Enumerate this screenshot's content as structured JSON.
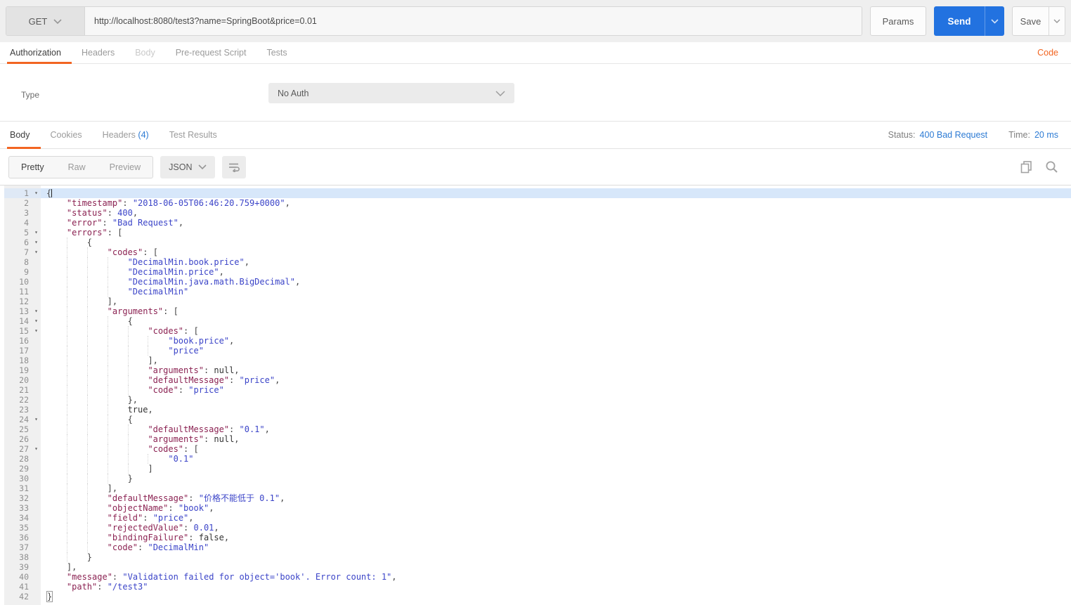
{
  "request_bar": {
    "method": "GET",
    "url": "http://localhost:8080/test3?name=SpringBoot&price=0.01",
    "params_label": "Params",
    "send_label": "Send",
    "save_label": "Save"
  },
  "request_tabs": {
    "authorization": "Authorization",
    "headers": "Headers",
    "body": "Body",
    "prerequest": "Pre-request Script",
    "tests": "Tests",
    "code_link": "Code"
  },
  "auth": {
    "type_label": "Type",
    "type_value": "No Auth"
  },
  "response_tabs": {
    "body": "Body",
    "cookies": "Cookies",
    "headers": "Headers",
    "headers_count": "(4)",
    "test_results": "Test Results",
    "status_label": "Status:",
    "status_value": "400 Bad Request",
    "time_label": "Time:",
    "time_value": "20 ms"
  },
  "viewer": {
    "mode_pretty": "Pretty",
    "mode_raw": "Raw",
    "mode_preview": "Preview",
    "language": "JSON",
    "icons": [
      "chevron-down-icon",
      "wrap-text-icon",
      "copy-icon",
      "search-icon"
    ]
  },
  "colors": {
    "accent_orange": "#f26522",
    "send_blue": "#2272e0",
    "link_blue": "#2d7bd4",
    "json_key": "#8b2252",
    "json_string_number": "#3b44c8",
    "active_line_bg": "#d7e7fa"
  },
  "code": {
    "active_line": 1,
    "cursor_line": 1,
    "bracket_box_line": 42,
    "fold_lines": [
      1,
      5,
      6,
      7,
      13,
      14,
      15,
      24,
      27
    ],
    "lines": [
      {
        "n": 1,
        "indent": 0,
        "tokens": [
          [
            "p",
            "{"
          ]
        ]
      },
      {
        "n": 2,
        "indent": 1,
        "tokens": [
          [
            "k",
            "\"timestamp\""
          ],
          [
            "p",
            ": "
          ],
          [
            "s",
            "\"2018-06-05T06:46:20.759+0000\""
          ],
          [
            "p",
            ","
          ]
        ]
      },
      {
        "n": 3,
        "indent": 1,
        "tokens": [
          [
            "k",
            "\"status\""
          ],
          [
            "p",
            ": "
          ],
          [
            "n",
            "400"
          ],
          [
            "p",
            ","
          ]
        ]
      },
      {
        "n": 4,
        "indent": 1,
        "tokens": [
          [
            "k",
            "\"error\""
          ],
          [
            "p",
            ": "
          ],
          [
            "s",
            "\"Bad Request\""
          ],
          [
            "p",
            ","
          ]
        ]
      },
      {
        "n": 5,
        "indent": 1,
        "tokens": [
          [
            "k",
            "\"errors\""
          ],
          [
            "p",
            ": ["
          ]
        ]
      },
      {
        "n": 6,
        "indent": 2,
        "tokens": [
          [
            "p",
            "{"
          ]
        ]
      },
      {
        "n": 7,
        "indent": 3,
        "tokens": [
          [
            "k",
            "\"codes\""
          ],
          [
            "p",
            ": ["
          ]
        ]
      },
      {
        "n": 8,
        "indent": 4,
        "tokens": [
          [
            "s",
            "\"DecimalMin.book.price\""
          ],
          [
            "p",
            ","
          ]
        ]
      },
      {
        "n": 9,
        "indent": 4,
        "tokens": [
          [
            "s",
            "\"DecimalMin.price\""
          ],
          [
            "p",
            ","
          ]
        ]
      },
      {
        "n": 10,
        "indent": 4,
        "tokens": [
          [
            "s",
            "\"DecimalMin.java.math.BigDecimal\""
          ],
          [
            "p",
            ","
          ]
        ]
      },
      {
        "n": 11,
        "indent": 4,
        "tokens": [
          [
            "s",
            "\"DecimalMin\""
          ]
        ]
      },
      {
        "n": 12,
        "indent": 3,
        "tokens": [
          [
            "p",
            "],"
          ]
        ]
      },
      {
        "n": 13,
        "indent": 3,
        "tokens": [
          [
            "k",
            "\"arguments\""
          ],
          [
            "p",
            ": ["
          ]
        ]
      },
      {
        "n": 14,
        "indent": 4,
        "tokens": [
          [
            "p",
            "{"
          ]
        ]
      },
      {
        "n": 15,
        "indent": 5,
        "tokens": [
          [
            "k",
            "\"codes\""
          ],
          [
            "p",
            ": ["
          ]
        ]
      },
      {
        "n": 16,
        "indent": 6,
        "tokens": [
          [
            "s",
            "\"book.price\""
          ],
          [
            "p",
            ","
          ]
        ]
      },
      {
        "n": 17,
        "indent": 6,
        "tokens": [
          [
            "s",
            "\"price\""
          ]
        ]
      },
      {
        "n": 18,
        "indent": 5,
        "tokens": [
          [
            "p",
            "],"
          ]
        ]
      },
      {
        "n": 19,
        "indent": 5,
        "tokens": [
          [
            "k",
            "\"arguments\""
          ],
          [
            "p",
            ": "
          ],
          [
            "a",
            "null"
          ],
          [
            "p",
            ","
          ]
        ]
      },
      {
        "n": 20,
        "indent": 5,
        "tokens": [
          [
            "k",
            "\"defaultMessage\""
          ],
          [
            "p",
            ": "
          ],
          [
            "s",
            "\"price\""
          ],
          [
            "p",
            ","
          ]
        ]
      },
      {
        "n": 21,
        "indent": 5,
        "tokens": [
          [
            "k",
            "\"code\""
          ],
          [
            "p",
            ": "
          ],
          [
            "s",
            "\"price\""
          ]
        ]
      },
      {
        "n": 22,
        "indent": 4,
        "tokens": [
          [
            "p",
            "},"
          ]
        ]
      },
      {
        "n": 23,
        "indent": 4,
        "tokens": [
          [
            "a",
            "true"
          ],
          [
            "p",
            ","
          ]
        ]
      },
      {
        "n": 24,
        "indent": 4,
        "tokens": [
          [
            "p",
            "{"
          ]
        ]
      },
      {
        "n": 25,
        "indent": 5,
        "tokens": [
          [
            "k",
            "\"defaultMessage\""
          ],
          [
            "p",
            ": "
          ],
          [
            "s",
            "\"0.1\""
          ],
          [
            "p",
            ","
          ]
        ]
      },
      {
        "n": 26,
        "indent": 5,
        "tokens": [
          [
            "k",
            "\"arguments\""
          ],
          [
            "p",
            ": "
          ],
          [
            "a",
            "null"
          ],
          [
            "p",
            ","
          ]
        ]
      },
      {
        "n": 27,
        "indent": 5,
        "tokens": [
          [
            "k",
            "\"codes\""
          ],
          [
            "p",
            ": ["
          ]
        ]
      },
      {
        "n": 28,
        "indent": 6,
        "tokens": [
          [
            "s",
            "\"0.1\""
          ]
        ]
      },
      {
        "n": 29,
        "indent": 5,
        "tokens": [
          [
            "p",
            "]"
          ]
        ]
      },
      {
        "n": 30,
        "indent": 4,
        "tokens": [
          [
            "p",
            "}"
          ]
        ]
      },
      {
        "n": 31,
        "indent": 3,
        "tokens": [
          [
            "p",
            "],"
          ]
        ]
      },
      {
        "n": 32,
        "indent": 3,
        "tokens": [
          [
            "k",
            "\"defaultMessage\""
          ],
          [
            "p",
            ": "
          ],
          [
            "s",
            "\"价格不能低于 0.1\""
          ],
          [
            "p",
            ","
          ]
        ]
      },
      {
        "n": 33,
        "indent": 3,
        "tokens": [
          [
            "k",
            "\"objectName\""
          ],
          [
            "p",
            ": "
          ],
          [
            "s",
            "\"book\""
          ],
          [
            "p",
            ","
          ]
        ]
      },
      {
        "n": 34,
        "indent": 3,
        "tokens": [
          [
            "k",
            "\"field\""
          ],
          [
            "p",
            ": "
          ],
          [
            "s",
            "\"price\""
          ],
          [
            "p",
            ","
          ]
        ]
      },
      {
        "n": 35,
        "indent": 3,
        "tokens": [
          [
            "k",
            "\"rejectedValue\""
          ],
          [
            "p",
            ": "
          ],
          [
            "n",
            "0.01"
          ],
          [
            "p",
            ","
          ]
        ]
      },
      {
        "n": 36,
        "indent": 3,
        "tokens": [
          [
            "k",
            "\"bindingFailure\""
          ],
          [
            "p",
            ": "
          ],
          [
            "a",
            "false"
          ],
          [
            "p",
            ","
          ]
        ]
      },
      {
        "n": 37,
        "indent": 3,
        "tokens": [
          [
            "k",
            "\"code\""
          ],
          [
            "p",
            ": "
          ],
          [
            "s",
            "\"DecimalMin\""
          ]
        ]
      },
      {
        "n": 38,
        "indent": 2,
        "tokens": [
          [
            "p",
            "}"
          ]
        ]
      },
      {
        "n": 39,
        "indent": 1,
        "tokens": [
          [
            "p",
            "],"
          ]
        ]
      },
      {
        "n": 40,
        "indent": 1,
        "tokens": [
          [
            "k",
            "\"message\""
          ],
          [
            "p",
            ": "
          ],
          [
            "s",
            "\"Validation failed for object='book'. Error count: 1\""
          ],
          [
            "p",
            ","
          ]
        ]
      },
      {
        "n": 41,
        "indent": 1,
        "tokens": [
          [
            "k",
            "\"path\""
          ],
          [
            "p",
            ": "
          ],
          [
            "s",
            "\"/test3\""
          ]
        ]
      },
      {
        "n": 42,
        "indent": 0,
        "tokens": [
          [
            "p",
            "}"
          ]
        ]
      }
    ]
  }
}
